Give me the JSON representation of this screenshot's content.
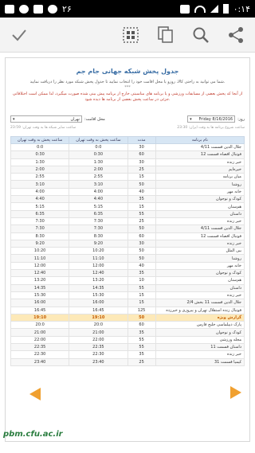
{
  "status_bar": {
    "time_label": "۲۶",
    "clock": "۰:۱۴"
  },
  "page": {
    "title": "جدول پخش شبکه جهانی جام جم",
    "description": "شما می توانید به راحتی کالا، روزو یا محل اقامت خود را انتخاب نمایید تا جدول پخش شبکه مورد نظر را دریافت نمایید.",
    "separator": "***",
    "warning": "از آنجا که پخش بعضی از مسابقات ورزشی و یا برنامه های مناسبتی خارج از برنامه پیش بینی شده صورت میگیرد، لذا ممکن است اختلافاتی جزئی در ساعت پخش بعضی از برنامه ها دیده شود.",
    "day_label": "روز:",
    "day_value": "Friday 8/16/2016",
    "city_label": "محل اقامت:",
    "city_value": "تهران",
    "note_right": "ساعت شروع برنامه ها به وقت ایران:",
    "note_right_value": "23:30",
    "note_left": "ساعت سایر شبکه ها به وقت تهران:",
    "note_left_value": "23:59"
  },
  "table": {
    "headers": [
      "نام برنامه",
      "مدت",
      "ساعت پخش به وقت تهران",
      "ساعت پخش به وقت تهران"
    ],
    "rows": [
      [
        "جلال الدین قسمت 4/11",
        "30",
        "0:0",
        "0:0"
      ],
      [
        "فوتبال اقصاه قسمت 12",
        "60",
        "0:30",
        "0:30"
      ],
      [
        "خبر زنده",
        "30",
        "1:30",
        "1:30"
      ],
      [
        "خیره‌ایم",
        "25",
        "2:00",
        "2:00"
      ],
      [
        "میان برنامه",
        "15",
        "2:55",
        "2:55"
      ],
      [
        "روشنا",
        "50",
        "3:10",
        "3:10"
      ],
      [
        "خانه مهر",
        "40",
        "4:00",
        "4:00"
      ],
      [
        "کودک و نوجوان",
        "35",
        "4:40",
        "4:40"
      ],
      [
        "هم‌سنان",
        "15",
        "5:15",
        "5:15"
      ],
      [
        "داستان",
        "55",
        "6:35",
        "6:35"
      ],
      [
        "خبر زنده",
        "25",
        "7:30",
        "7:30"
      ],
      [
        "جلال الدین قسمت 4/11",
        "50",
        "7:30",
        "7:30"
      ],
      [
        "فوتبال اقصاه قسمت 12",
        "60",
        "8:30",
        "8:30"
      ],
      [
        "خبر زنده",
        "30",
        "9:20",
        "9:20"
      ],
      [
        "بین الملل",
        "50",
        "10:20",
        "10:20"
      ],
      [
        "روشنا",
        "50",
        "11:10",
        "11:10"
      ],
      [
        "خانه مهر",
        "40",
        "12:00",
        "12:00"
      ],
      [
        "کودک و نوجوان",
        "35",
        "12:40",
        "12:40"
      ],
      [
        "هم‌سنان",
        "10",
        "13:20",
        "13:20"
      ],
      [
        "داستان",
        "55",
        "14:35",
        "14:35"
      ],
      [
        "خبر زنده",
        "15",
        "15:30",
        "15:30"
      ],
      [
        "جلال الدین قسمت 11 بخش 2/4",
        "15",
        "16:00",
        "16:00"
      ],
      [
        "فوتبال زنده استقلال تهران و پیروزی و خیرزده",
        "125",
        "16:45",
        "16:45"
      ],
      [
        "گزارش ویژه",
        "50",
        "19:10",
        "19:10"
      ],
      [
        "پارک دیپلماسی خلیج فارس",
        "60",
        "20:0",
        "20:0"
      ],
      [
        "کودک و نوجوان",
        "35",
        "21:00",
        "21:00"
      ],
      [
        "مجله ورزشی",
        "55",
        "22:00",
        "22:00"
      ],
      [
        "داستان قسمت 11",
        "55",
        "22:35",
        "22:35"
      ],
      [
        "خبر زنده",
        "35",
        "22:30",
        "22:30"
      ],
      [
        "کیمیا قسمت 31",
        "25",
        "23:40",
        "23:40"
      ]
    ],
    "highlight_row": 23
  },
  "watermark": "pbm.cfu.ac.ir",
  "colors": {
    "accent": "#f0a030",
    "header": "#d7e6f4",
    "title": "#3a6ea5"
  }
}
